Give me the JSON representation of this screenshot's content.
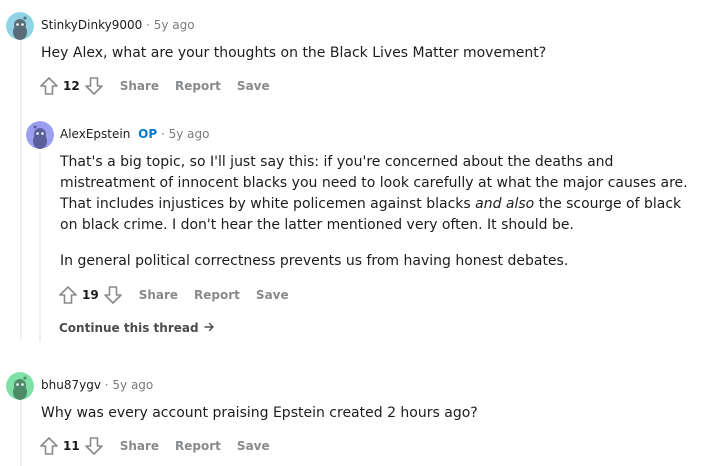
{
  "comments": [
    {
      "username": "StinkyDinky9000",
      "time": "5y ago",
      "body": [
        "Hey Alex, what are your thoughts on the Black Lives Matter movement?"
      ],
      "score": "12",
      "actions": [
        "Share",
        "Report",
        "Save"
      ],
      "avatar_color": "#8fd3e5"
    },
    {
      "username": "AlexEpstein",
      "op_badge": "OP",
      "time": "5y ago",
      "body": [
        "That's a big topic, so I'll just say this: if you're concerned about the deaths and mistreatment of innocent blacks you need to look carefully at what the major causes are. That includes injustices by white policemen against blacks",
        "and also",
        "the scourge of black on black crime. I don't hear the latter mentioned very often. It should be.",
        "In general political correctness prevents us from having honest debates."
      ],
      "score": "19",
      "actions": [
        "Share",
        "Report",
        "Save"
      ],
      "continue_label": "Continue this thread",
      "avatar_color": "#9b9ef0"
    },
    {
      "username": "bhu87ygv",
      "time": "5y ago",
      "body": [
        "Why was every account praising Epstein created 2 hours ago?"
      ],
      "score": "11",
      "actions": [
        "Share",
        "Report",
        "Save"
      ],
      "avatar_color": "#7fe0a8"
    }
  ],
  "meta_separator": "·",
  "colors": {
    "op_blue": "#0079d3",
    "action_gray": "#878a8c",
    "thread_line": "#edeff1"
  },
  "icons": [
    "upvote-icon",
    "downvote-icon",
    "snoo-avatar-icon",
    "arrow-right-icon"
  ]
}
